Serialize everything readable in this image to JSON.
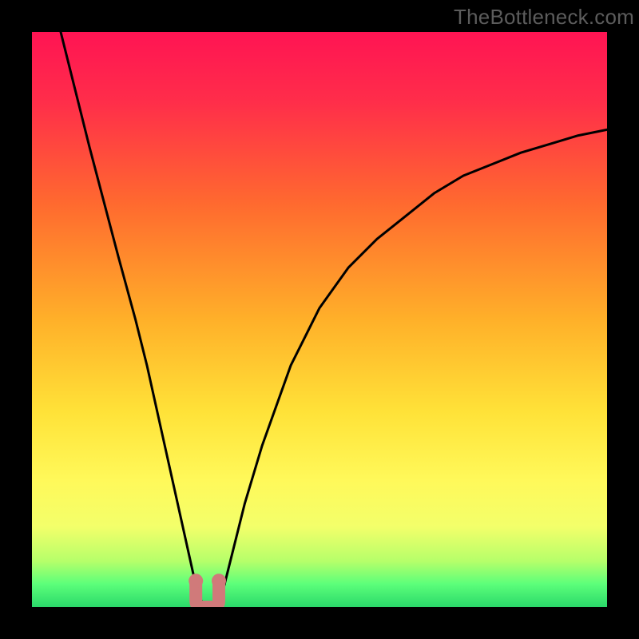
{
  "watermark": {
    "text": "TheBottleneck.com"
  },
  "chart_data": {
    "type": "line",
    "title": "",
    "xlabel": "",
    "ylabel": "",
    "xlim": [
      0,
      100
    ],
    "ylim": [
      0,
      100
    ],
    "series": [
      {
        "name": "bottleneck-curve",
        "x": [
          5,
          10,
          15,
          18,
          20,
          22,
          24,
          26,
          28,
          29,
          30,
          31,
          32,
          33,
          34,
          35,
          37,
          40,
          45,
          50,
          55,
          60,
          65,
          70,
          75,
          80,
          85,
          90,
          95,
          100
        ],
        "values": [
          100,
          80,
          61,
          50,
          42,
          33,
          24,
          15,
          6,
          2,
          0,
          0,
          0,
          2,
          6,
          10,
          18,
          28,
          42,
          52,
          59,
          64,
          68,
          72,
          75,
          77,
          79,
          80.5,
          82,
          83
        ]
      }
    ],
    "dip": {
      "x_center": 30.5,
      "width": 4,
      "marker_color": "#d07a7a"
    },
    "gradient_stops": [
      {
        "pct": 0,
        "color": "#ff1453"
      },
      {
        "pct": 12,
        "color": "#ff2d4a"
      },
      {
        "pct": 30,
        "color": "#ff6a2f"
      },
      {
        "pct": 50,
        "color": "#ffb029"
      },
      {
        "pct": 66,
        "color": "#ffe238"
      },
      {
        "pct": 78,
        "color": "#fff95a"
      },
      {
        "pct": 86,
        "color": "#f3ff6a"
      },
      {
        "pct": 92,
        "color": "#b6ff6a"
      },
      {
        "pct": 96,
        "color": "#5cff7a"
      },
      {
        "pct": 100,
        "color": "#2bd96a"
      }
    ]
  }
}
